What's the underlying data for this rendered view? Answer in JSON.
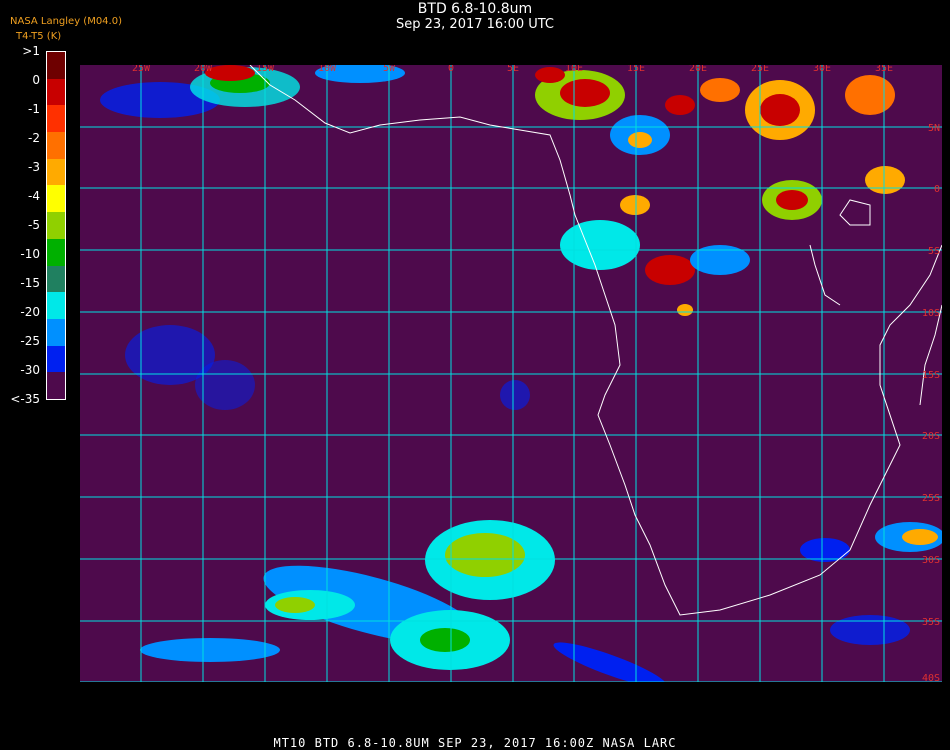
{
  "header": {
    "title": "BTD 6.8-10.8um",
    "subtitle": "Sep 23, 2017 16:00 UTC",
    "org": "NASA Langley (M04.0)",
    "unit": "T4-T5 (K)"
  },
  "colorbar": {
    "labels": [
      ">1",
      "0",
      "-1",
      "-2",
      "-3",
      "-4",
      "-5",
      "-10",
      "-15",
      "-20",
      "-25",
      "-30",
      "<-35"
    ],
    "colors": [
      "#6e0000",
      "#c80000",
      "#ff3000",
      "#ff7000",
      "#ffaa00",
      "#ffff00",
      "#90d000",
      "#00b000",
      "#208060",
      "#00e8e8",
      "#0090ff",
      "#0020f0",
      "#4e0a4c"
    ]
  },
  "map": {
    "background": "#4e0a4c",
    "grid_color": "#00e0e0",
    "coast_color": "#ffffff",
    "lon_labels": [
      "25W",
      "20W",
      "15W",
      "10W",
      "5W",
      "0",
      "5E",
      "10E",
      "15E",
      "20E",
      "25E",
      "30E",
      "35E"
    ],
    "lat_labels": [
      "5N",
      "0",
      "5S",
      "10S",
      "15S",
      "20S",
      "25S",
      "30S",
      "35S",
      "40S"
    ]
  },
  "footer": {
    "text": "MT10  BTD 6.8-10.8UM   SEP 23, 2017 16:00Z   NASA LARC"
  }
}
